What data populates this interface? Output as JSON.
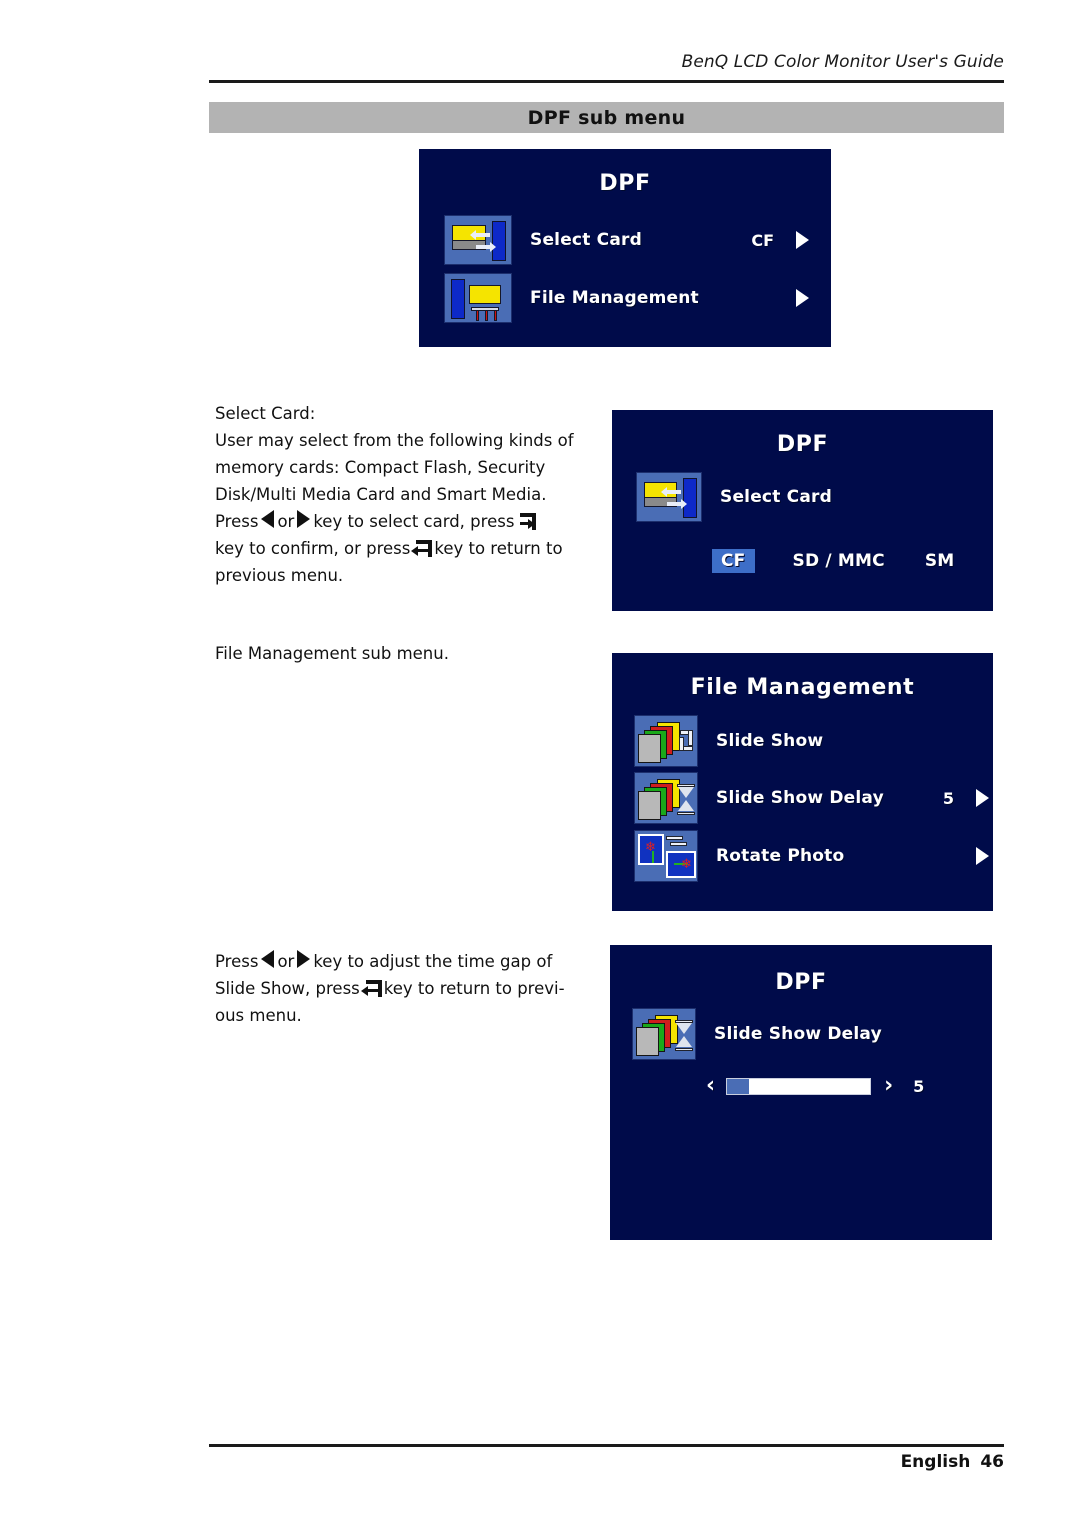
{
  "header": {
    "running_head": "BenQ LCD Color Monitor User's Guide",
    "section_title": "DPF sub menu"
  },
  "footer": {
    "language": "English",
    "page_number": "46"
  },
  "colors": {
    "osd_background": "#000b4a",
    "osd_text": "#ffffff",
    "icon_tile": "#4a6db5",
    "highlight": "#3d6ec8",
    "title_bar": "#b3b3b3",
    "rule": "#1a1a1a"
  },
  "osd_panels": {
    "dpf_main": {
      "title": "DPF",
      "rows": [
        {
          "icon": "select-card-icon",
          "label": "Select Card",
          "value": "CF",
          "arrow": "triangle-right"
        },
        {
          "icon": "file-management-icon",
          "label": "File Management",
          "value": "",
          "arrow": "triangle-right"
        }
      ]
    },
    "select_card": {
      "title": "DPF",
      "rows": [
        {
          "icon": "select-card-icon",
          "label": "Select Card"
        }
      ],
      "options": [
        {
          "label": "CF",
          "selected": true
        },
        {
          "label": "SD / MMC",
          "selected": false
        },
        {
          "label": "SM",
          "selected": false
        }
      ]
    },
    "file_management": {
      "title": "File Management",
      "rows": [
        {
          "icon": "slide-show-icon",
          "label": "Slide Show",
          "value": "",
          "arrow": ""
        },
        {
          "icon": "slide-show-delay-icon",
          "label": "Slide Show Delay",
          "value": "5",
          "arrow": "triangle-right"
        },
        {
          "icon": "rotate-photo-icon",
          "label": "Rotate Photo",
          "value": "",
          "arrow": "triangle-right"
        }
      ]
    },
    "slide_show_delay": {
      "title": "DPF",
      "rows": [
        {
          "icon": "slide-show-delay-icon",
          "label": "Slide Show Delay"
        }
      ],
      "slider": {
        "left_chevron": "‹",
        "right_chevron": "›",
        "value": "5",
        "fill_percent": 15
      }
    }
  },
  "body": {
    "select_card_block": {
      "heading": "Select Card:",
      "line1": "User may select from the following kinds of",
      "line2": "memory cards: Compact Flash, Security",
      "line3": "Disk/Multi Media Card and Smart Media.",
      "line4_a": "Press",
      "line4_b": "or",
      "line4_c": "key to select card, press",
      "line5_a": "key to confirm, or press",
      "line5_b": "key to return to",
      "line6": "previous menu."
    },
    "file_management_block": {
      "text": "File Management sub menu."
    },
    "slide_show_block": {
      "line1_a": "Press",
      "line1_b": "or",
      "line1_c": "key to adjust the time gap of",
      "line2_a": "Slide Show, press",
      "line2_b": "key to return to previ-",
      "line3": "ous menu."
    }
  }
}
